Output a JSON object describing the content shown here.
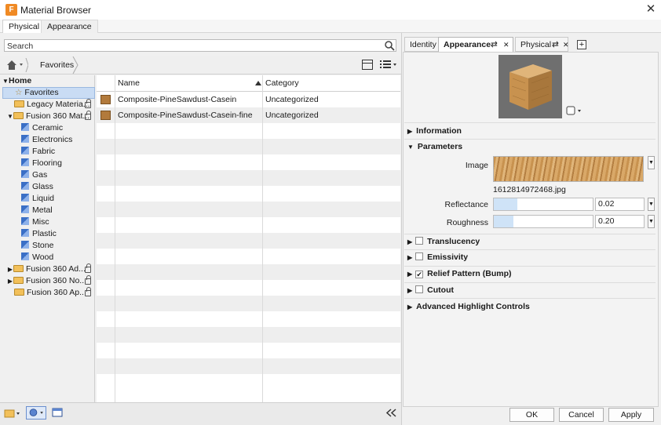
{
  "window": {
    "title": "Material Browser",
    "app_icon": "F",
    "close": "✕"
  },
  "top_tabs": [
    {
      "label": "Physical"
    },
    {
      "label": "Appearance"
    }
  ],
  "search": {
    "placeholder": "Search"
  },
  "nav": {
    "crumb": "Favorites"
  },
  "tree": {
    "home": "Home",
    "favorites": "Favorites",
    "legacy": "Legacy Materia...",
    "fusion_mat": "Fusion 360 Mat...",
    "children": [
      "Ceramic",
      "Electronics",
      "Fabric",
      "Flooring",
      "Gas",
      "Glass",
      "Liquid",
      "Metal",
      "Misc",
      "Plastic",
      "Stone",
      "Wood"
    ],
    "fusion_ad": "Fusion 360 Ad...",
    "fusion_no": "Fusion 360 No...",
    "fusion_ap": "Fusion 360 Ap..."
  },
  "grid": {
    "headers": {
      "name": "Name",
      "category": "Category"
    },
    "rows": [
      {
        "name": "Composite-PineSawdust-Casein",
        "category": "Uncategorized"
      },
      {
        "name": "Composite-PineSawdust-Casein-fine",
        "category": "Uncategorized"
      }
    ]
  },
  "right_tabs": {
    "identity": "Identity",
    "appearance": "Appearance",
    "physical": "Physical"
  },
  "sections": {
    "information": "Information",
    "parameters": "Parameters",
    "translucency": "Translucency",
    "emissivity": "Emissivity",
    "relief": "Relief Pattern (Bump)",
    "cutout": "Cutout",
    "advanced": "Advanced Highlight Controls"
  },
  "params": {
    "image_label": "Image",
    "image_file": "1612814972468.jpg",
    "reflectance_label": "Reflectance",
    "reflectance_value": "0.02",
    "reflectance_fraction": 0.02,
    "roughness_label": "Roughness",
    "roughness_value": "0.20",
    "roughness_fraction": 0.2
  },
  "checks": {
    "translucency": false,
    "emissivity": false,
    "relief": true,
    "cutout": false
  },
  "buttons": {
    "ok": "OK",
    "cancel": "Cancel",
    "apply": "Apply"
  },
  "colors": {
    "accent": "#3a6fc6",
    "selection": "#c9dcf4",
    "wood": "#c8924f"
  }
}
